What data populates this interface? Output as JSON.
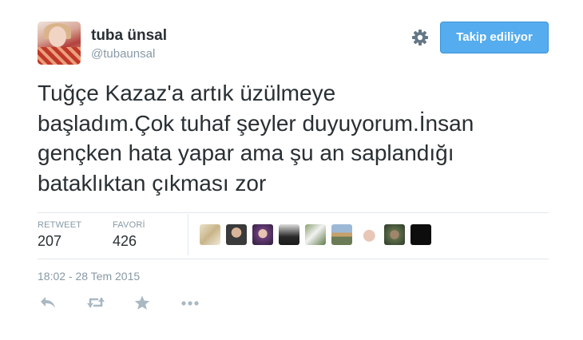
{
  "user": {
    "display_name": "tuba ünsal",
    "handle": "@tubaunsal"
  },
  "header": {
    "follow_button_label": "Takip ediliyor"
  },
  "tweet": {
    "text_lines": [
      "Tuğçe Kazaz'a artık üzülmeye",
      "başladım.Çok tuhaf şeyler duyuyorum.İnsan",
      "gençken hata yapar ama şu an saplandığı",
      "bataklıktan çıkması zor"
    ],
    "timestamp": "18:02 - 28 Tem 2015"
  },
  "stats": {
    "retweet_label": "RETWEET",
    "retweet_count": "207",
    "favorite_label": "FAVORİ",
    "favorite_count": "426"
  },
  "favorited_by_count": 9,
  "colors": {
    "accent": "#55acee",
    "text": "#292f33",
    "muted": "#8899a6",
    "divider": "#e1e8ed",
    "action_icon": "#aab8c2"
  },
  "icons": {
    "settings": "gear-icon",
    "reply": "reply-icon",
    "retweet": "retweet-icon",
    "favorite": "star-icon",
    "more": "more-icon"
  }
}
